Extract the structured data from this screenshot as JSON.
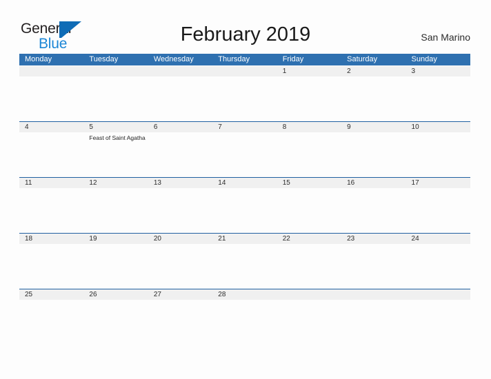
{
  "brand": {
    "name_part1": "General",
    "name_part2": "Blue",
    "mark": "sail-triangle",
    "color_dark": "#231f20",
    "color_blue": "#1b86d6",
    "color_mark": "#0f6cb6"
  },
  "header": {
    "title": "February 2019",
    "location": "San Marino"
  },
  "colors": {
    "header_bar": "#2e70b0",
    "row_rule": "#1f5fa0",
    "daynum_band": "#f0f0f0",
    "page_background": "#fdfdfd"
  },
  "calendar": {
    "weekdays": [
      "Monday",
      "Tuesday",
      "Wednesday",
      "Thursday",
      "Friday",
      "Saturday",
      "Sunday"
    ],
    "weeks": [
      [
        {
          "num": "",
          "events": []
        },
        {
          "num": "",
          "events": []
        },
        {
          "num": "",
          "events": []
        },
        {
          "num": "",
          "events": []
        },
        {
          "num": "1",
          "events": []
        },
        {
          "num": "2",
          "events": []
        },
        {
          "num": "3",
          "events": []
        }
      ],
      [
        {
          "num": "4",
          "events": []
        },
        {
          "num": "5",
          "events": [
            "Feast of Saint Agatha"
          ]
        },
        {
          "num": "6",
          "events": []
        },
        {
          "num": "7",
          "events": []
        },
        {
          "num": "8",
          "events": []
        },
        {
          "num": "9",
          "events": []
        },
        {
          "num": "10",
          "events": []
        }
      ],
      [
        {
          "num": "11",
          "events": []
        },
        {
          "num": "12",
          "events": []
        },
        {
          "num": "13",
          "events": []
        },
        {
          "num": "14",
          "events": []
        },
        {
          "num": "15",
          "events": []
        },
        {
          "num": "16",
          "events": []
        },
        {
          "num": "17",
          "events": []
        }
      ],
      [
        {
          "num": "18",
          "events": []
        },
        {
          "num": "19",
          "events": []
        },
        {
          "num": "20",
          "events": []
        },
        {
          "num": "21",
          "events": []
        },
        {
          "num": "22",
          "events": []
        },
        {
          "num": "23",
          "events": []
        },
        {
          "num": "24",
          "events": []
        }
      ],
      [
        {
          "num": "25",
          "events": []
        },
        {
          "num": "26",
          "events": []
        },
        {
          "num": "27",
          "events": []
        },
        {
          "num": "28",
          "events": []
        },
        {
          "num": "",
          "events": []
        },
        {
          "num": "",
          "events": []
        },
        {
          "num": "",
          "events": []
        }
      ]
    ]
  }
}
